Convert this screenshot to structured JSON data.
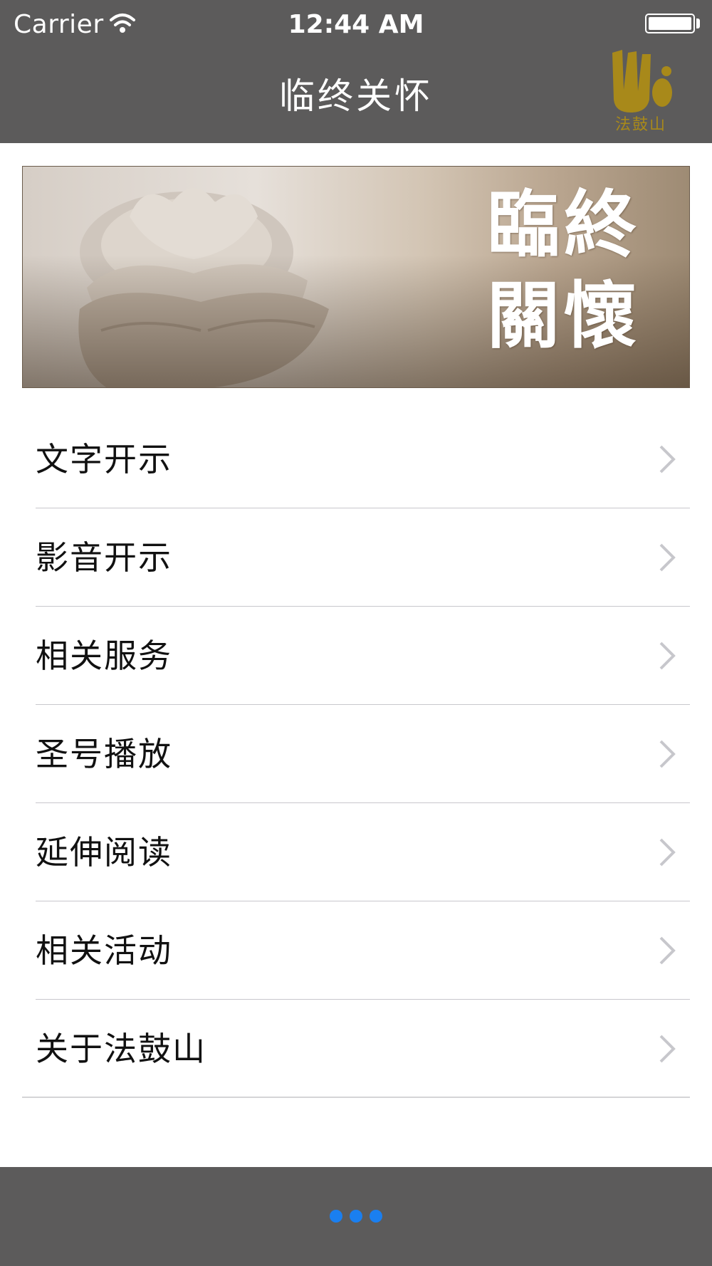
{
  "status_bar": {
    "carrier": "Carrier",
    "time": "12:44 AM"
  },
  "nav": {
    "title": "临终关怀",
    "logo_text": "法鼓山"
  },
  "banner": {
    "line1": "臨終",
    "line2": "關懷"
  },
  "menu": {
    "items": [
      {
        "label": "文字开示"
      },
      {
        "label": "影音开示"
      },
      {
        "label": "相关服务"
      },
      {
        "label": "圣号播放"
      },
      {
        "label": "延伸阅读"
      },
      {
        "label": "相关活动"
      },
      {
        "label": "关于法鼓山"
      }
    ]
  },
  "page_indicator": {
    "count": 3
  },
  "colors": {
    "bar_background": "#5c5b5b",
    "logo_gold": "#a8891a",
    "dot_blue": "#1a7ff0"
  },
  "icons": {
    "wifi": "wifi-icon",
    "battery": "battery-icon",
    "chevron": "chevron-right-icon",
    "logo": "dharma-drum-logo"
  }
}
